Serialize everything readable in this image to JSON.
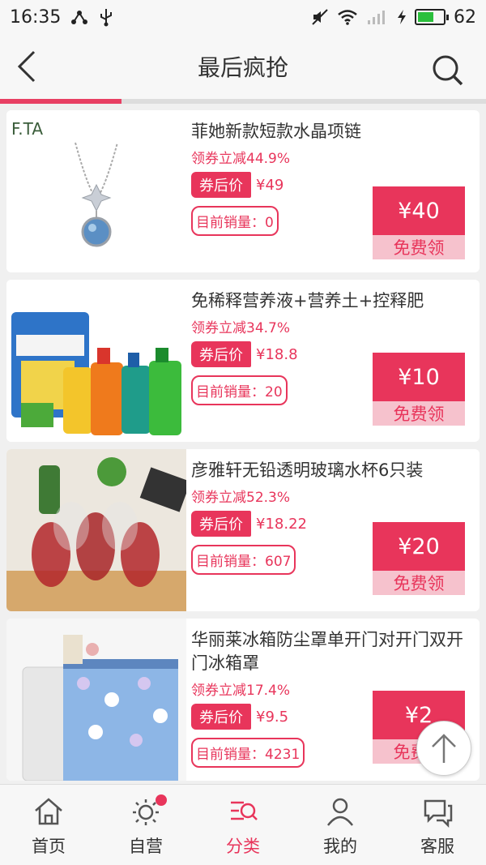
{
  "status": {
    "time": "16:35",
    "battery": "62",
    "battery_level": 0.62
  },
  "header": {
    "title": "最后疯抢"
  },
  "scroll_progress": 0.25,
  "products": [
    {
      "title": "菲她新款短款水晶项链",
      "coupon_text": "领券立减44.9%",
      "after_label": "券后价",
      "after_price": "¥49",
      "sales": "目前销量：0",
      "coupon_amount": "¥40",
      "coupon_cta": "免费领",
      "brand": "F.TA"
    },
    {
      "title": "免稀释营养液+营养土+控释肥",
      "coupon_text": "领券立减34.7%",
      "after_label": "券后价",
      "after_price": "¥18.8",
      "sales": "目前销量：20",
      "coupon_amount": "¥10",
      "coupon_cta": "免费领"
    },
    {
      "title": "彦雅轩无铅透明玻璃水杯6只装",
      "coupon_text": "领券立减52.3%",
      "after_label": "券后价",
      "after_price": "¥18.22",
      "sales": "目前销量：607",
      "coupon_amount": "¥20",
      "coupon_cta": "免费领"
    },
    {
      "title": "华丽莱冰箱防尘罩单开门对开门双开门冰箱罩",
      "coupon_text": "领券立减17.4%",
      "after_label": "券后价",
      "after_price": "¥9.5",
      "sales": "目前销量：4231",
      "coupon_amount": "¥2",
      "coupon_cta": "免费领"
    }
  ],
  "tabs": [
    {
      "label": "首页",
      "icon": "home-icon"
    },
    {
      "label": "自营",
      "icon": "sun-icon",
      "badge": true
    },
    {
      "label": "分类",
      "icon": "category-icon",
      "active": true
    },
    {
      "label": "我的",
      "icon": "user-icon"
    },
    {
      "label": "客服",
      "icon": "chat-icon"
    }
  ],
  "colors": {
    "accent": "#e8355b",
    "coupon_light": "#f6c2cd"
  }
}
